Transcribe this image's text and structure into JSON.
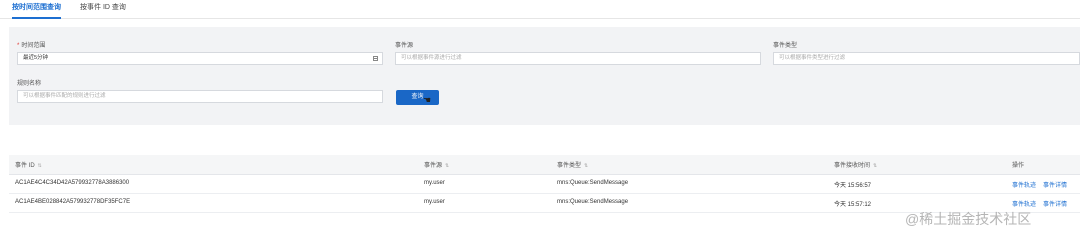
{
  "tabs": [
    {
      "label": "按时间范围查询",
      "active": true
    },
    {
      "label": "按事件 ID 查询",
      "active": false
    }
  ],
  "filters": {
    "time_range": {
      "required_mark": "*",
      "label": "时间范围",
      "value": "最近5分钟"
    },
    "event_source": {
      "label": "事件源",
      "placeholder": "可以根据事件源进行过滤"
    },
    "event_type": {
      "label": "事件类型",
      "placeholder": "可以根据事件类型进行过滤"
    },
    "rule_name": {
      "label": "规则名称",
      "placeholder": "可以根据事件匹配的规则进行过滤"
    },
    "query_label": "查询"
  },
  "table": {
    "columns": [
      "事件 ID",
      "事件源",
      "事件类型",
      "事件接收时间",
      "操作"
    ],
    "rows": [
      {
        "id": "AC1AE4C4C34D42A579932778A3886300",
        "source": "my.user",
        "type": "mns:Queue:SendMessage",
        "time": "今天 15:56:57",
        "action1": "事件轨迹",
        "action2": "事件详情"
      },
      {
        "id": "AC1AE4BE028842A579932778DF35FC7E",
        "source": "my.user",
        "type": "mns:Queue:SendMessage",
        "time": "今天 15:57:12",
        "action1": "事件轨迹",
        "action2": "事件详情"
      }
    ]
  },
  "watermark": "@稀土掘金技术社区"
}
